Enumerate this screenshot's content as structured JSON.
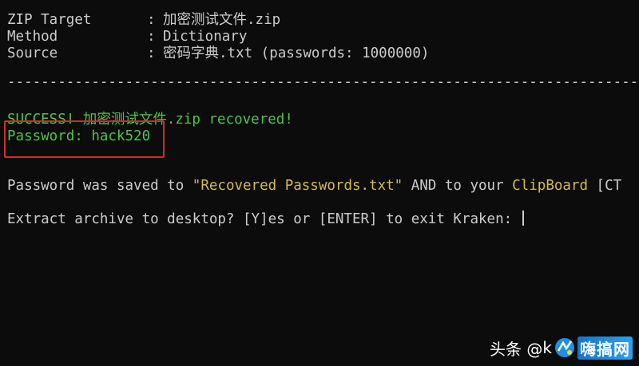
{
  "info": {
    "zip_target_label": "ZIP Target",
    "zip_target_value": "加密测试文件.zip",
    "method_label": "Method",
    "method_value": "Dictionary",
    "source_label": "Source",
    "source_value": "密码字典.txt (passwords: 1000000)",
    "separator": ": "
  },
  "divider": "-------------------------------------------------------------------------------------------",
  "result": {
    "success_text": "SUCCESS! 加密测试文件.zip recovered!",
    "password_text": "Password: hack520"
  },
  "saved": {
    "prefix": "Password was saved to ",
    "file": "\"Recovered Passwords.txt\"",
    "middle": " AND to your ",
    "clipboard": "ClipBoard",
    "suffix": " [CT"
  },
  "prompt": {
    "text": "Extract archive to desktop? [Y]es or [ENTER] to exit Kraken: "
  },
  "watermark": {
    "prefix": "头条 @",
    "letter": "k",
    "site": "嗨搞网"
  },
  "colors": {
    "background": "#0c0c0c",
    "text": "#cccccc",
    "success": "#4ec34e",
    "highlight": "#d7ba4e",
    "annotation_box": "#d42a2a"
  }
}
